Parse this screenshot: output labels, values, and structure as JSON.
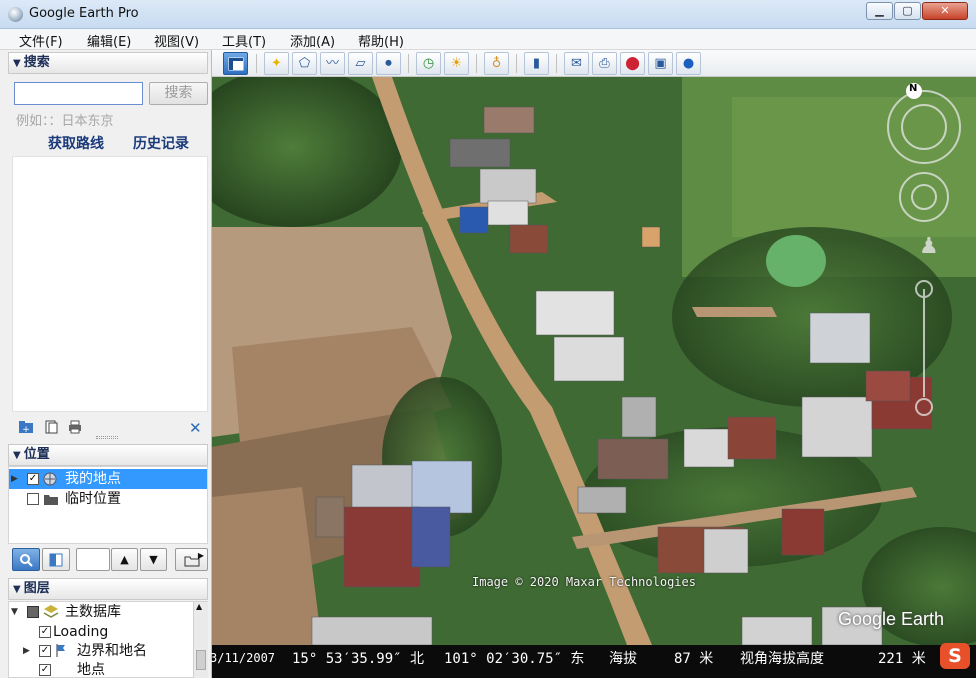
{
  "window": {
    "title": "Google Earth Pro",
    "min_label": "▁",
    "max_label": "▢",
    "close_label": "✕"
  },
  "menu": [
    {
      "label": "文件(F)"
    },
    {
      "label": "编辑(E)"
    },
    {
      "label": "视图(V)"
    },
    {
      "label": "工具(T)"
    },
    {
      "label": "添加(A)"
    },
    {
      "label": "帮助(H)"
    }
  ],
  "search": {
    "header": "搜索",
    "input_value": "",
    "button_label": "搜索",
    "example": "例如：：日本东京",
    "route_link": "获取路线",
    "history_link": "历史记录"
  },
  "places": {
    "header": "位置",
    "items": [
      {
        "label": "我的地点",
        "checked": true,
        "selected": true
      },
      {
        "label": "临时位置",
        "checked": false,
        "selected": false
      }
    ]
  },
  "layers": {
    "header": "图层",
    "items": [
      {
        "label": "主数据库",
        "checked": true
      },
      {
        "label": "Loading",
        "checked": true
      },
      {
        "label": "边界和地名",
        "checked": true
      },
      {
        "label": "地点",
        "checked": true
      }
    ]
  },
  "status": {
    "date": "3/11/2007",
    "lat": "15° 53′35.99″ 北",
    "lon": "101° 02′30.75″ 东",
    "elev_label": "海拔",
    "elev_value": "87 米",
    "eye_label": "视角海拔高度",
    "eye_value": "221 米"
  },
  "map": {
    "copyright": "Image © 2020 Maxar Technologies",
    "logo": "Google Earth",
    "compass_north": "N"
  },
  "ime": {
    "label": "S"
  },
  "icons": {
    "toolbar": [
      "sidebar-icon",
      "placemark-icon",
      "polygon-icon",
      "path-icon",
      "overlay-icon",
      "tour-icon",
      "history-icon",
      "sun-icon",
      "planet-icon",
      "ruler-icon",
      "email-icon",
      "print-icon",
      "maps-icon",
      "save-image-icon",
      "earth-icon"
    ]
  }
}
